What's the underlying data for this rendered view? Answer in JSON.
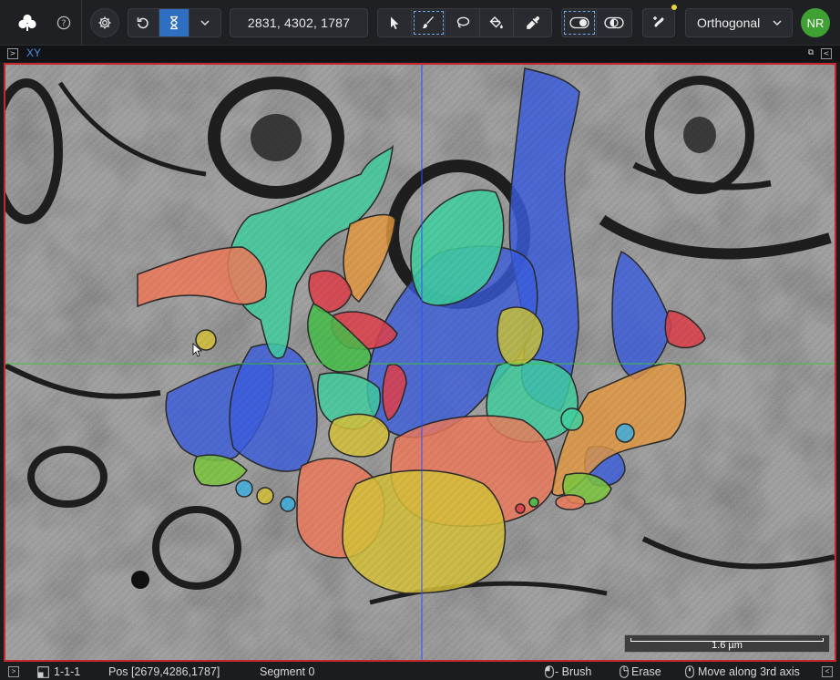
{
  "toolbar": {
    "position_readout": "2831, 4302, 1787",
    "view_mode": "Orthogonal",
    "user_initials": "NR"
  },
  "panel": {
    "title": "XY"
  },
  "viewer": {
    "scale_label": "1.6 µm"
  },
  "status": {
    "zoom": "1-1-1",
    "position": "Pos [2679,4286,1787]",
    "segment": "Segment 0",
    "hint_brush": "- Brush",
    "hint_erase": "Erase",
    "hint_axis": "Move along 3rd axis"
  },
  "colors": {
    "accent": "#2f6fc1",
    "viewport_border": "#c4272c",
    "avatar": "#3fa033",
    "crosshair_blue": "#3050ff",
    "crosshair_green": "#40c040",
    "segment_blue": "#3b5ee0",
    "segment_teal": "#3fd2a0",
    "segment_salmon": "#f07a5a",
    "segment_red": "#e0404a",
    "segment_yellow": "#d6c23a",
    "segment_orange": "#e89a40",
    "segment_green": "#46c04a"
  }
}
